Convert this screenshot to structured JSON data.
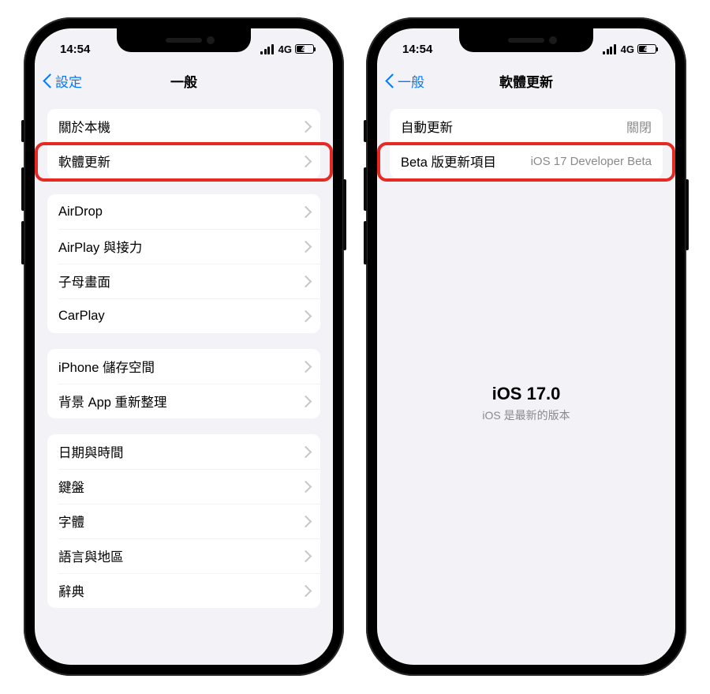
{
  "status": {
    "time": "14:54",
    "network": "4G",
    "battery": "41"
  },
  "left": {
    "back": "設定",
    "title": "一般",
    "g1": [
      {
        "label": "關於本機"
      },
      {
        "label": "軟體更新"
      }
    ],
    "g2": [
      {
        "label": "AirDrop"
      },
      {
        "label": "AirPlay 與接力"
      },
      {
        "label": "子母畫面"
      },
      {
        "label": "CarPlay"
      }
    ],
    "g3": [
      {
        "label": "iPhone 儲存空間"
      },
      {
        "label": "背景 App 重新整理"
      }
    ],
    "g4": [
      {
        "label": "日期與時間"
      },
      {
        "label": "鍵盤"
      },
      {
        "label": "字體"
      },
      {
        "label": "語言與地區"
      },
      {
        "label": "辭典"
      }
    ]
  },
  "right": {
    "back": "一般",
    "title": "軟體更新",
    "rows": [
      {
        "label": "自動更新",
        "value": "關閉"
      },
      {
        "label": "Beta 版更新項目",
        "value": "iOS 17 Developer Beta"
      }
    ],
    "center": {
      "big": "iOS 17.0",
      "small": "iOS 是最新的版本"
    }
  }
}
